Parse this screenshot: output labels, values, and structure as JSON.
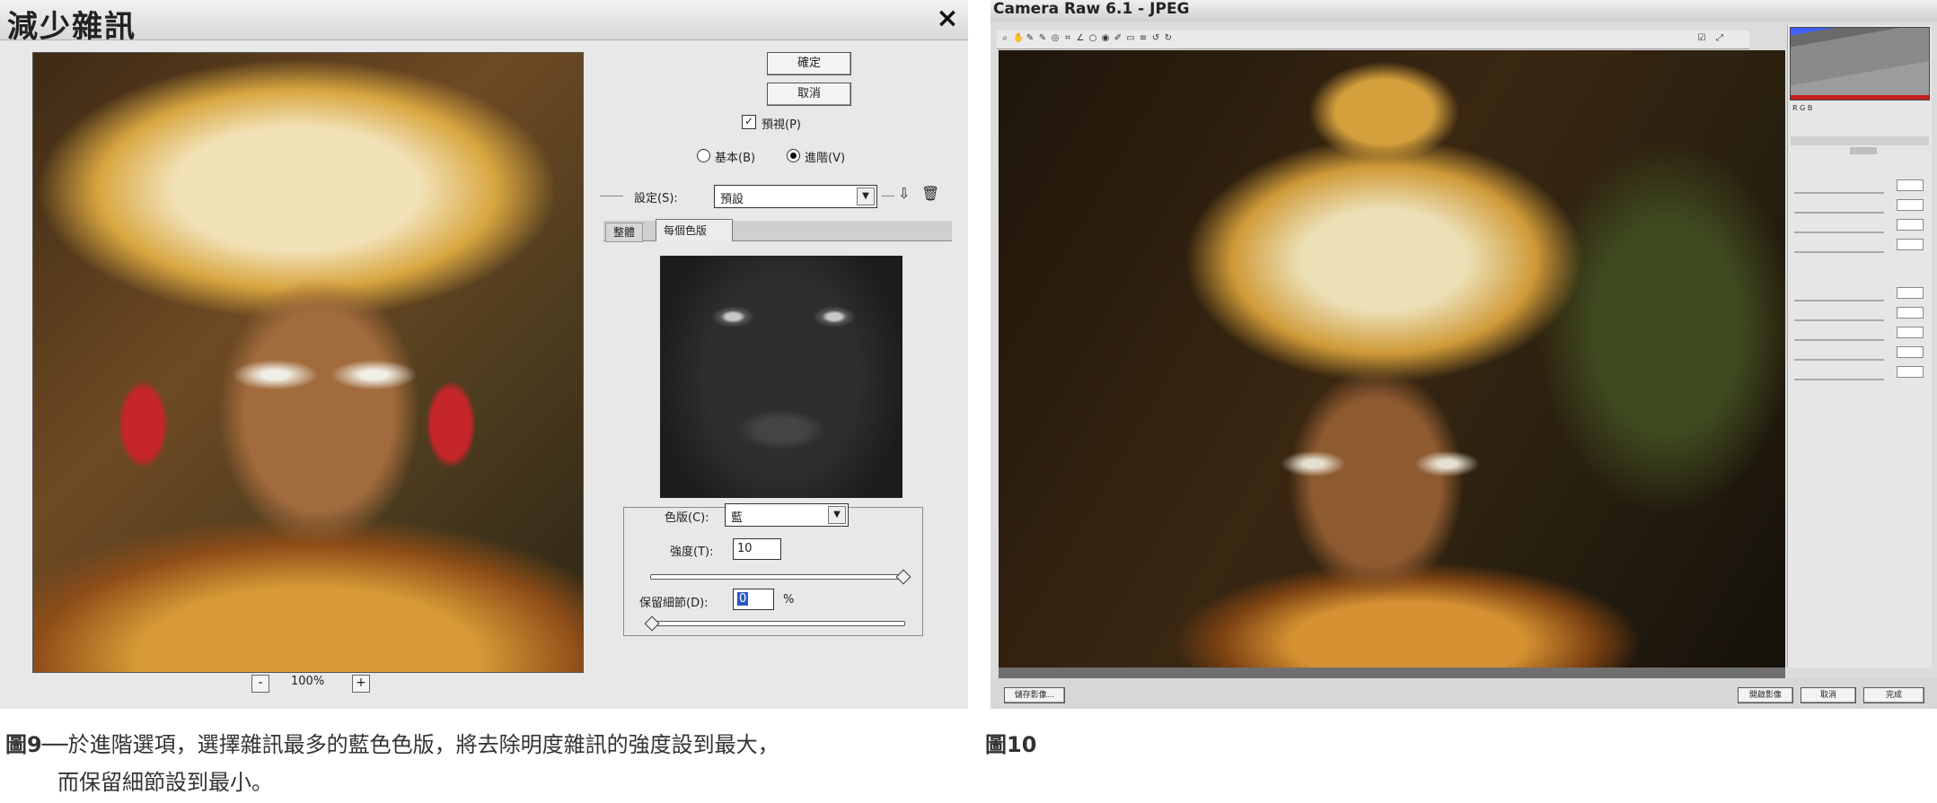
{
  "dialog": {
    "title": "減少雜訊",
    "close_label": "×",
    "ok_label": "確定",
    "cancel_label": "取消",
    "preview_label": "預視(P)",
    "preview_checked": true,
    "mode_basic_label": "基本(B)",
    "mode_advanced_label": "進階(V)",
    "mode_selected": "advanced",
    "settings_label": "設定(S):",
    "settings_value": "預設",
    "tabs": [
      "整體",
      "每個色版"
    ],
    "active_tab": "每個色版",
    "channel_label": "色版(C):",
    "channel_value": "藍",
    "strength_label": "強度(T):",
    "strength_value": "10",
    "preserve_label": "保留細節(D):",
    "preserve_value": "0",
    "preserve_unit": "%",
    "zoom_level": "100%",
    "zoom_out_label": "-",
    "zoom_in_label": "+"
  },
  "camera_raw": {
    "title": "Camera Raw 6.1  -  JPEG",
    "save_label": "儲存影像...",
    "open_label": "開啟影像",
    "cancel_label": "取消",
    "done_label": "完成"
  },
  "captions": {
    "fig9_number": "圖9",
    "fig9_text_line1": "──於進階選項，選擇雜訊最多的藍色色版，將去除明度雜訊的強度設到最大，",
    "fig9_text_line2": "而保留細節設到最小。",
    "fig10_number": "圖10"
  },
  "colors": {
    "dialog_bg": "#e8e8e8",
    "camera_raw_bg": "#dcdcdc",
    "link": "#2a3ea0"
  }
}
